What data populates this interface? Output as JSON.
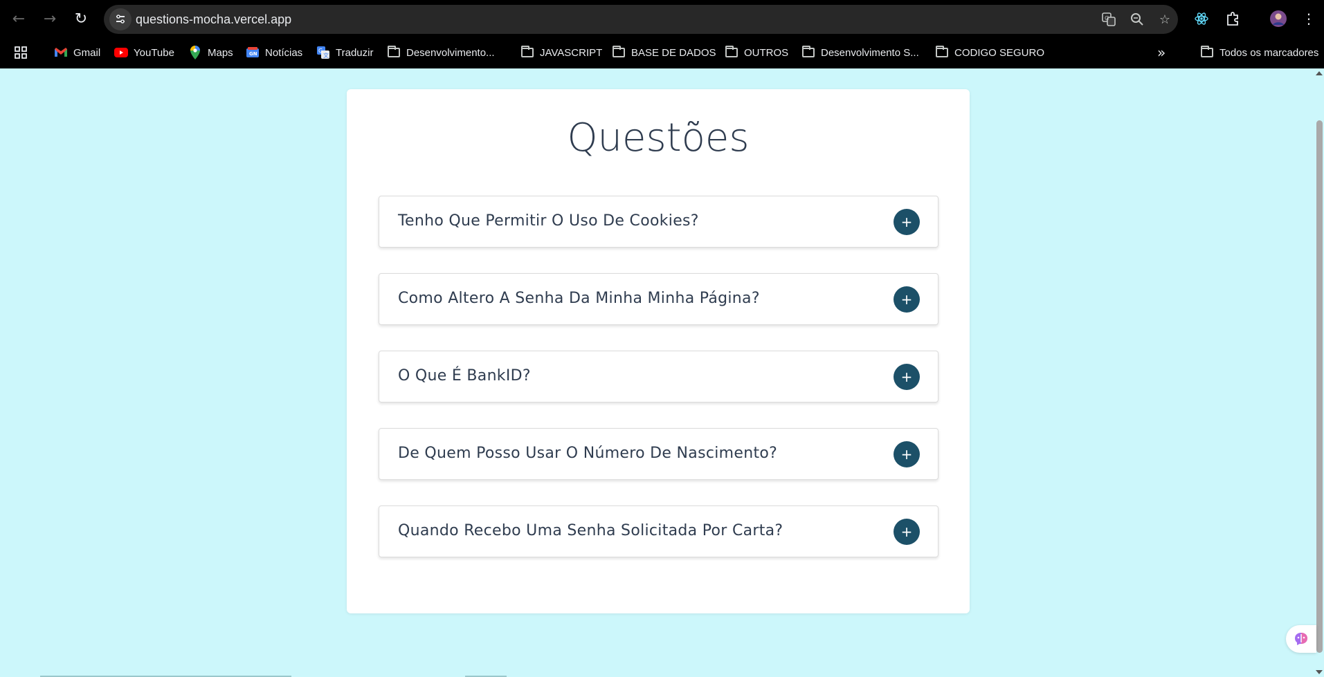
{
  "browser": {
    "url": "questions-mocha.vercel.app",
    "bookmarks": [
      {
        "label": "Gmail",
        "icon": "gmail-icon"
      },
      {
        "label": "YouTube",
        "icon": "youtube-icon"
      },
      {
        "label": "Maps",
        "icon": "maps-icon"
      },
      {
        "label": "Notícias",
        "icon": "news-icon"
      },
      {
        "label": "Traduzir",
        "icon": "translate-icon"
      },
      {
        "label": "Desenvolvimento...",
        "icon": "folder-icon"
      },
      {
        "label": "JAVASCRIPT",
        "icon": "folder-icon"
      },
      {
        "label": "BASE DE DADOS",
        "icon": "folder-icon"
      },
      {
        "label": "OUTROS",
        "icon": "folder-icon"
      },
      {
        "label": "Desenvolvimento S...",
        "icon": "folder-icon"
      },
      {
        "label": "CODIGO SEGURO",
        "icon": "folder-icon"
      }
    ],
    "all_bookmarks": "Todos os marcadores",
    "colors": {
      "chrome_bg": "#000000",
      "omnibox_bg": "#282828"
    }
  },
  "page": {
    "title": "Questões",
    "questions": [
      "Tenho Que Permitir O Uso De Cookies?",
      "Como Altero A Senha Da Minha Minha Página?",
      "O Que É BankID?",
      "De Quem Posso Usar O Número De Nascimento?",
      "Quando Recebo Uma Senha Solicitada Por Carta?"
    ],
    "expand_symbol": "+",
    "colors": {
      "background": "#ccf7fb",
      "card": "#ffffff",
      "text": "#2f3c4f",
      "button": "#1c5068"
    }
  }
}
